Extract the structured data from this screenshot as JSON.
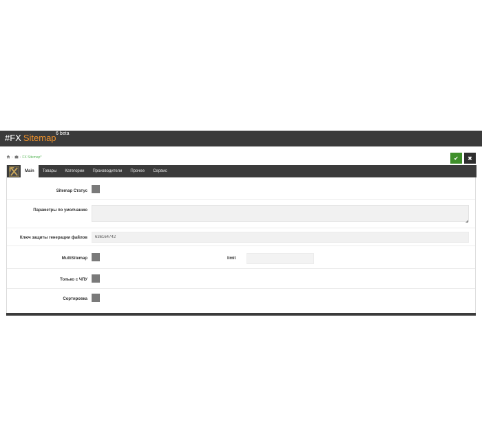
{
  "header": {
    "prefix": "#FX",
    "name": "Sitemap",
    "version": "6 beta"
  },
  "breadcrumb": {
    "home_icon": "home-icon",
    "module_icon": "puzzle-icon",
    "separator": "›",
    "current": "FX Sitemap*"
  },
  "actions": {
    "save_icon": "check-icon",
    "cancel_icon": "close-icon",
    "save_glyph": "✔",
    "cancel_glyph": "✖"
  },
  "tabs": [
    {
      "label": "Main",
      "active": true
    },
    {
      "label": "Товары",
      "active": false
    },
    {
      "label": "Категории",
      "active": false
    },
    {
      "label": "Производители",
      "active": false
    },
    {
      "label": "Прочее",
      "active": false
    },
    {
      "label": "Сервис",
      "active": false
    }
  ],
  "form": {
    "status_label": "Sitemap Статус",
    "defaults_label": "Параметры по умолчанию",
    "defaults_value": "",
    "key_label": "Ключ защиты генерации файлов",
    "key_value": "636164742",
    "multisitemap_label": "MultiSitemap",
    "limit_label": "limit",
    "limit_value": "",
    "chpu_label": "Только с ЧПУ",
    "sort_label": "Сортировка"
  },
  "colors": {
    "header_bg": "#3b3b3b",
    "brand_accent": "#f0922b",
    "save_green": "#3f8f2a",
    "breadcrumb_green": "#5cb85c",
    "checkbox_gray": "#7a7a7a"
  }
}
